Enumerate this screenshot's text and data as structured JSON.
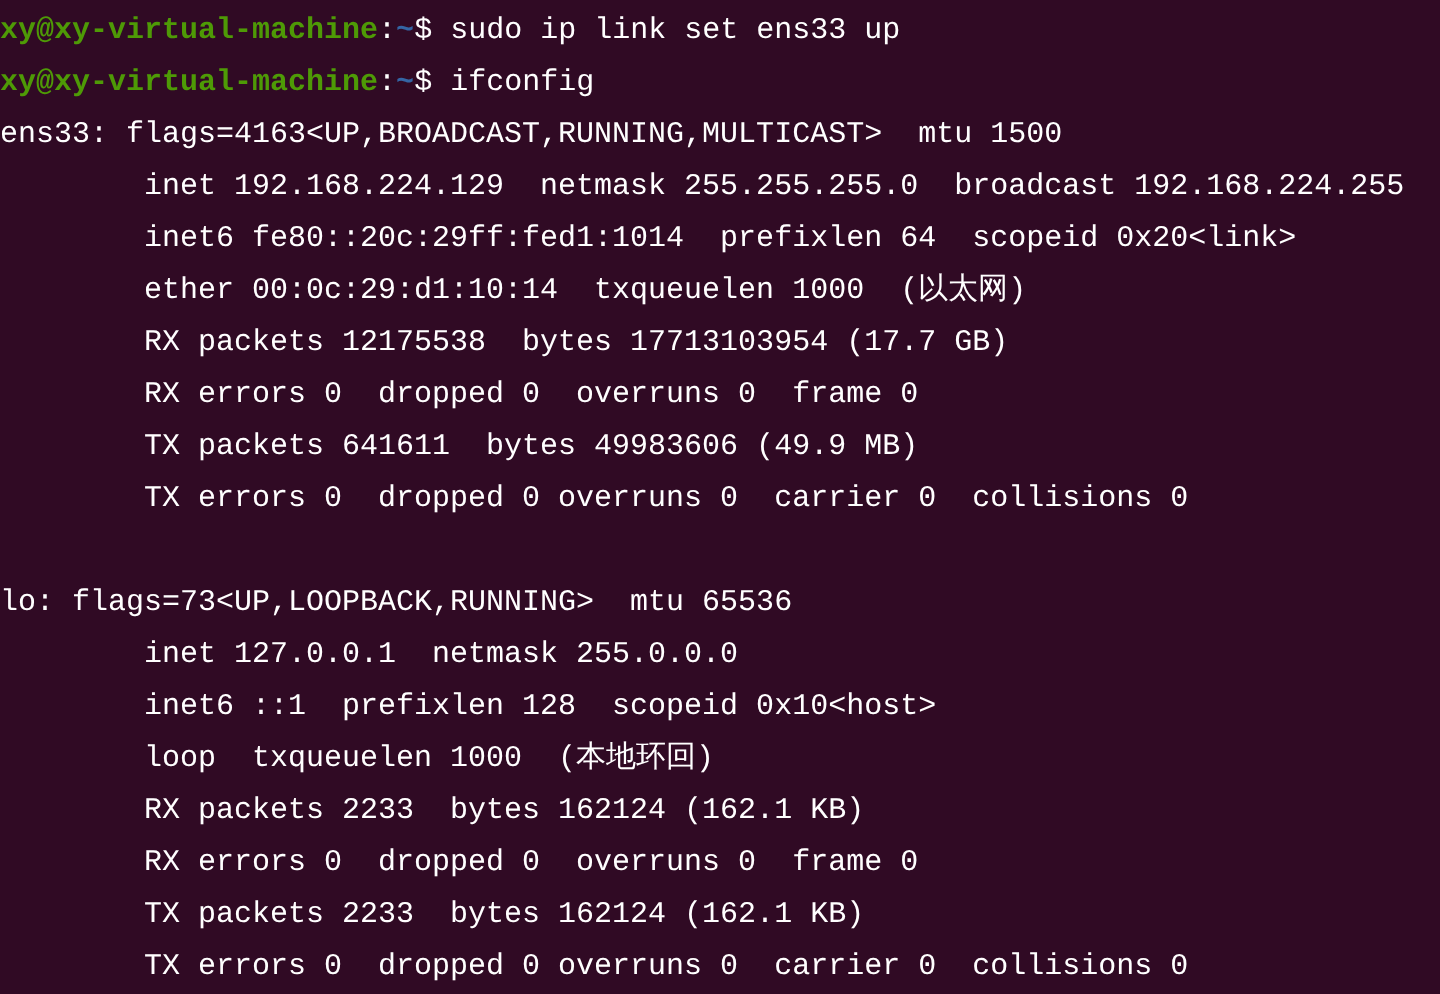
{
  "terminal": {
    "lines": [
      {
        "kind": "prompt",
        "user_host": "xy@xy-virtual-machine",
        "separator": ":",
        "path": "~",
        "symbol": "$",
        "command": "sudo ip link set ens33 up"
      },
      {
        "kind": "prompt",
        "user_host": "xy@xy-virtual-machine",
        "separator": ":",
        "path": "~",
        "symbol": "$",
        "command": "ifconfig"
      },
      {
        "kind": "output",
        "text": "ens33: flags=4163<UP,BROADCAST,RUNNING,MULTICAST>  mtu 1500"
      },
      {
        "kind": "output",
        "text": "        inet 192.168.224.129  netmask 255.255.255.0  broadcast 192.168.224.255"
      },
      {
        "kind": "output",
        "text": "        inet6 fe80::20c:29ff:fed1:1014  prefixlen 64  scopeid 0x20<link>"
      },
      {
        "kind": "output",
        "text": "        ether 00:0c:29:d1:10:14  txqueuelen 1000  (以太网)"
      },
      {
        "kind": "output",
        "text": "        RX packets 12175538  bytes 17713103954 (17.7 GB)"
      },
      {
        "kind": "output",
        "text": "        RX errors 0  dropped 0  overruns 0  frame 0"
      },
      {
        "kind": "output",
        "text": "        TX packets 641611  bytes 49983606 (49.9 MB)"
      },
      {
        "kind": "output",
        "text": "        TX errors 0  dropped 0 overruns 0  carrier 0  collisions 0"
      },
      {
        "kind": "blank"
      },
      {
        "kind": "output",
        "text": "lo: flags=73<UP,LOOPBACK,RUNNING>  mtu 65536"
      },
      {
        "kind": "output",
        "text": "        inet 127.0.0.1  netmask 255.0.0.0"
      },
      {
        "kind": "output",
        "text": "        inet6 ::1  prefixlen 128  scopeid 0x10<host>"
      },
      {
        "kind": "output",
        "text": "        loop  txqueuelen 1000  (本地环回)"
      },
      {
        "kind": "output",
        "text": "        RX packets 2233  bytes 162124 (162.1 KB)"
      },
      {
        "kind": "output",
        "text": "        RX errors 0  dropped 0  overruns 0  frame 0"
      },
      {
        "kind": "output",
        "text": "        TX packets 2233  bytes 162124 (162.1 KB)"
      },
      {
        "kind": "output",
        "text": "        TX errors 0  dropped 0 overruns 0  carrier 0  collisions 0"
      }
    ]
  }
}
